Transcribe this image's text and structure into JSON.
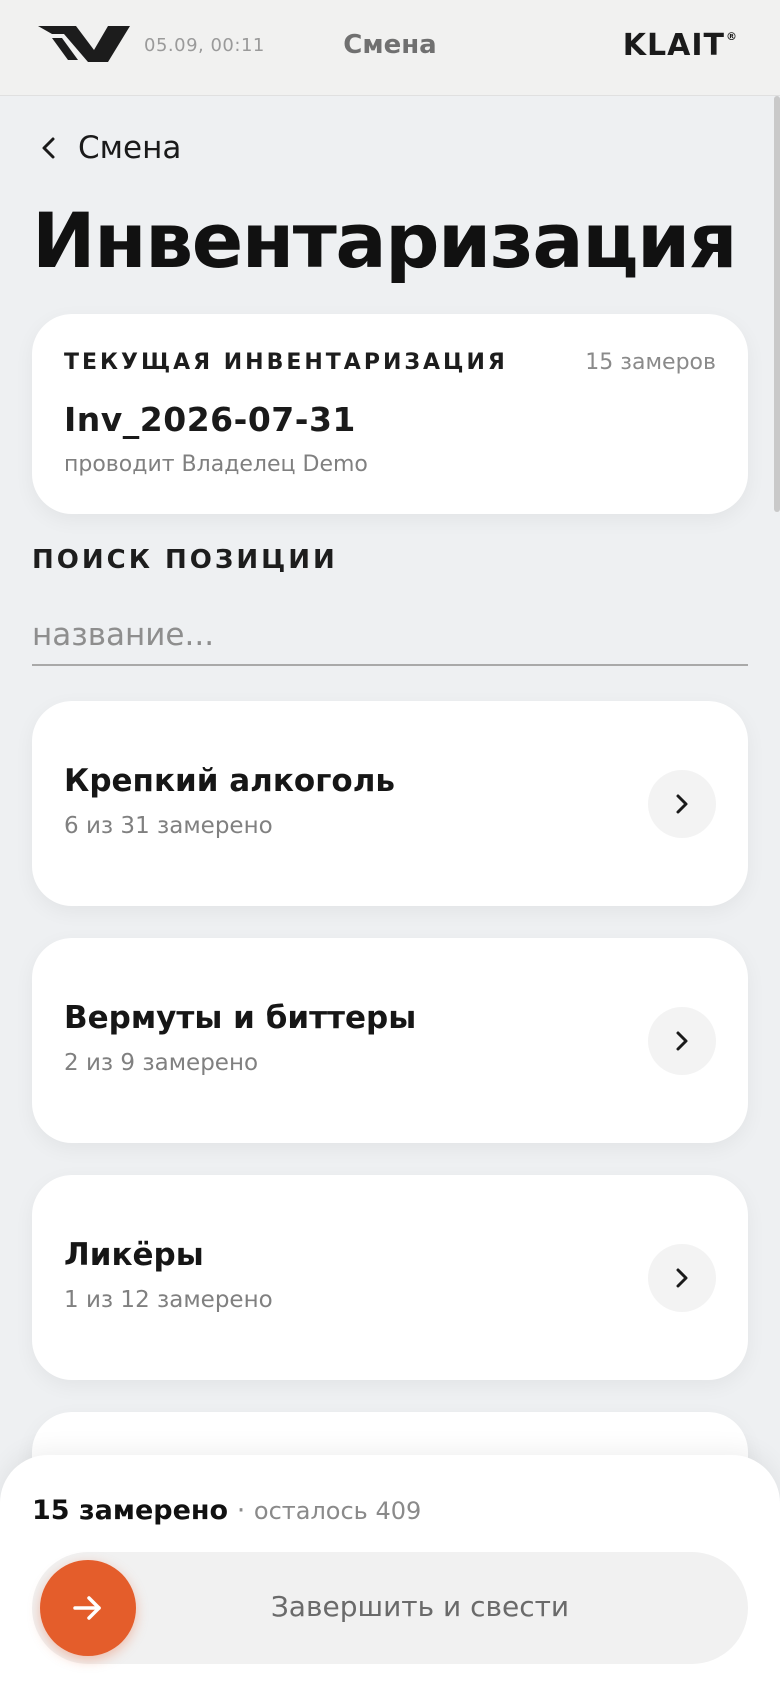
{
  "header": {
    "datetime": "05.09, 00:11",
    "title": "Смена",
    "brand": "KLAIT",
    "brand_mark": "®"
  },
  "nav": {
    "back_label": "Смена"
  },
  "page_title": "Инвентаризация",
  "current_inventory": {
    "heading": "ТЕКУЩАЯ ИНВЕНТАРИЗАЦИЯ",
    "count": "15 замеров",
    "name": "Inv_2026-07-31",
    "owner": "проводит Владелец Demo"
  },
  "search": {
    "label": "ПОИСК ПОЗИЦИИ",
    "placeholder": "название..."
  },
  "categories": [
    {
      "name": "Крепкий алкоголь",
      "progress": "6 из 31 замерено"
    },
    {
      "name": "Вермуты и биттеры",
      "progress": "2 из 9 замерено"
    },
    {
      "name": "Ликёры",
      "progress": "1 из 12 замерено"
    }
  ],
  "footer": {
    "measured": "15 замерено",
    "separator": "·",
    "remaining": "осталось 409",
    "finish_label": "Завершить и свести"
  },
  "colors": {
    "accent": "#e45d2b",
    "background": "#eef0f2",
    "card": "#ffffff"
  }
}
